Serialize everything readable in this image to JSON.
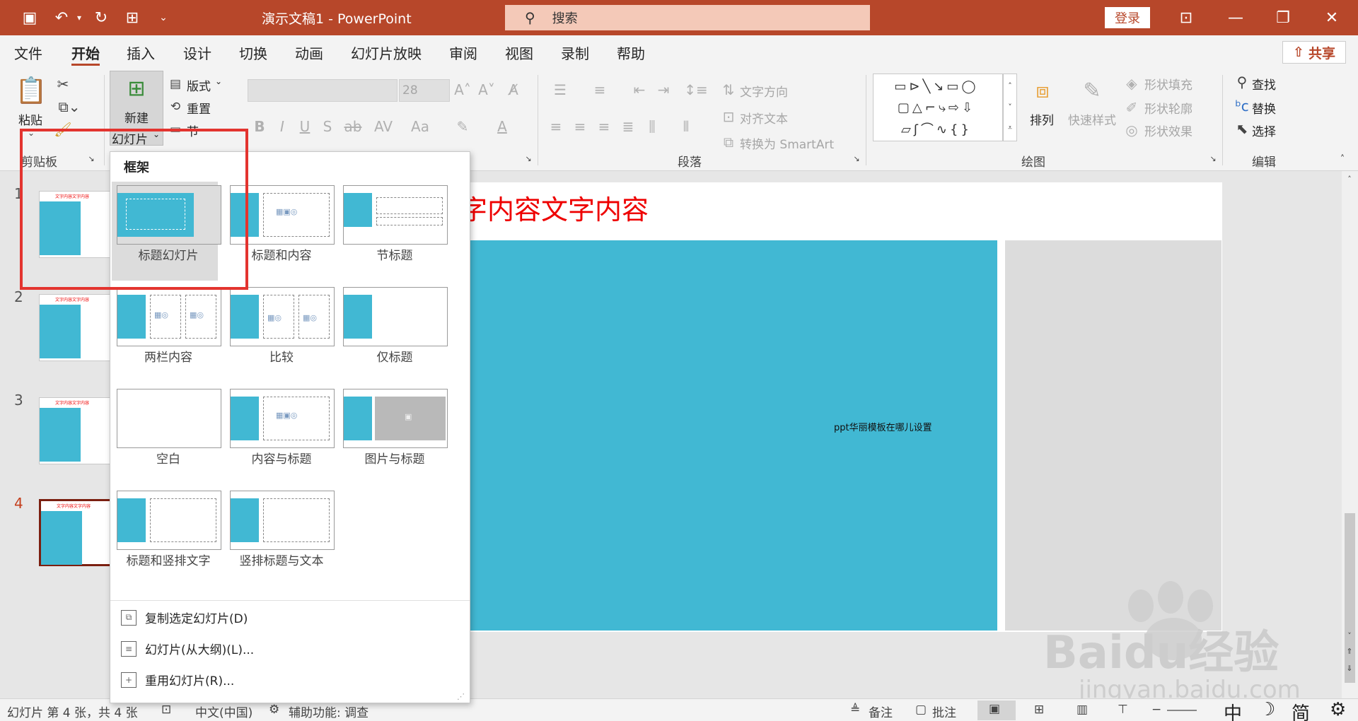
{
  "titlebar": {
    "title": "演示文稿1 - PowerPoint",
    "search": "搜索",
    "login": "登录"
  },
  "tabs": [
    "文件",
    "开始",
    "插入",
    "设计",
    "切换",
    "动画",
    "幻灯片放映",
    "审阅",
    "视图",
    "录制",
    "帮助"
  ],
  "active_tab": "开始",
  "share": "共享",
  "ribbon": {
    "paste": "粘贴",
    "clipboard_group": "剪贴板",
    "new_slide_line1": "新建",
    "new_slide_line2": "幻灯片",
    "layout": "版式",
    "reset": "重置",
    "section": "节",
    "font_size": "28",
    "text_direction": "文字方向",
    "align_text": "对齐文本",
    "convert_smartart": "转换为 SmartArt",
    "paragraph_group": "段落",
    "arrange": "排列",
    "quick_styles": "快速样式",
    "shape_fill": "形状填充",
    "shape_outline": "形状轮廓",
    "shape_effects": "形状效果",
    "drawing_group": "绘图",
    "find": "查找",
    "replace": "替换",
    "select": "选择",
    "editing_group": "编辑"
  },
  "thumbnails": [
    {
      "num": "1",
      "title": "文字内容文字内容"
    },
    {
      "num": "2",
      "title": "文字内容文字内容"
    },
    {
      "num": "3",
      "title": "文字内容文字内容"
    },
    {
      "num": "4",
      "title": "文字内容文字内容"
    }
  ],
  "slide": {
    "title": "字内容文字内容",
    "body": "ppt华丽模板在哪儿设置"
  },
  "dropdown": {
    "header": "框架",
    "layouts": [
      "标题幻灯片",
      "标题和内容",
      "节标题",
      "两栏内容",
      "比较",
      "仅标题",
      "空白",
      "内容与标题",
      "图片与标题",
      "标题和竖排文字",
      "竖排标题与文本"
    ],
    "actions": [
      "复制选定幻灯片(D)",
      "幻灯片(从大纲)(L)...",
      "重用幻灯片(R)..."
    ]
  },
  "status": {
    "slide_info": "幻灯片 第 4 张，共 4 张",
    "language": "中文(中国)",
    "accessibility": "辅助功能: 调查",
    "notes": "备注",
    "comments": "批注",
    "ime1": "中",
    "ime2": "简"
  },
  "watermark": {
    "brand": "Baidu经验",
    "url": "jingyan.baidu.com"
  },
  "colors": {
    "accent": "#b7472a",
    "slide_blue": "#41b8d3",
    "highlight": "#e3342f"
  }
}
